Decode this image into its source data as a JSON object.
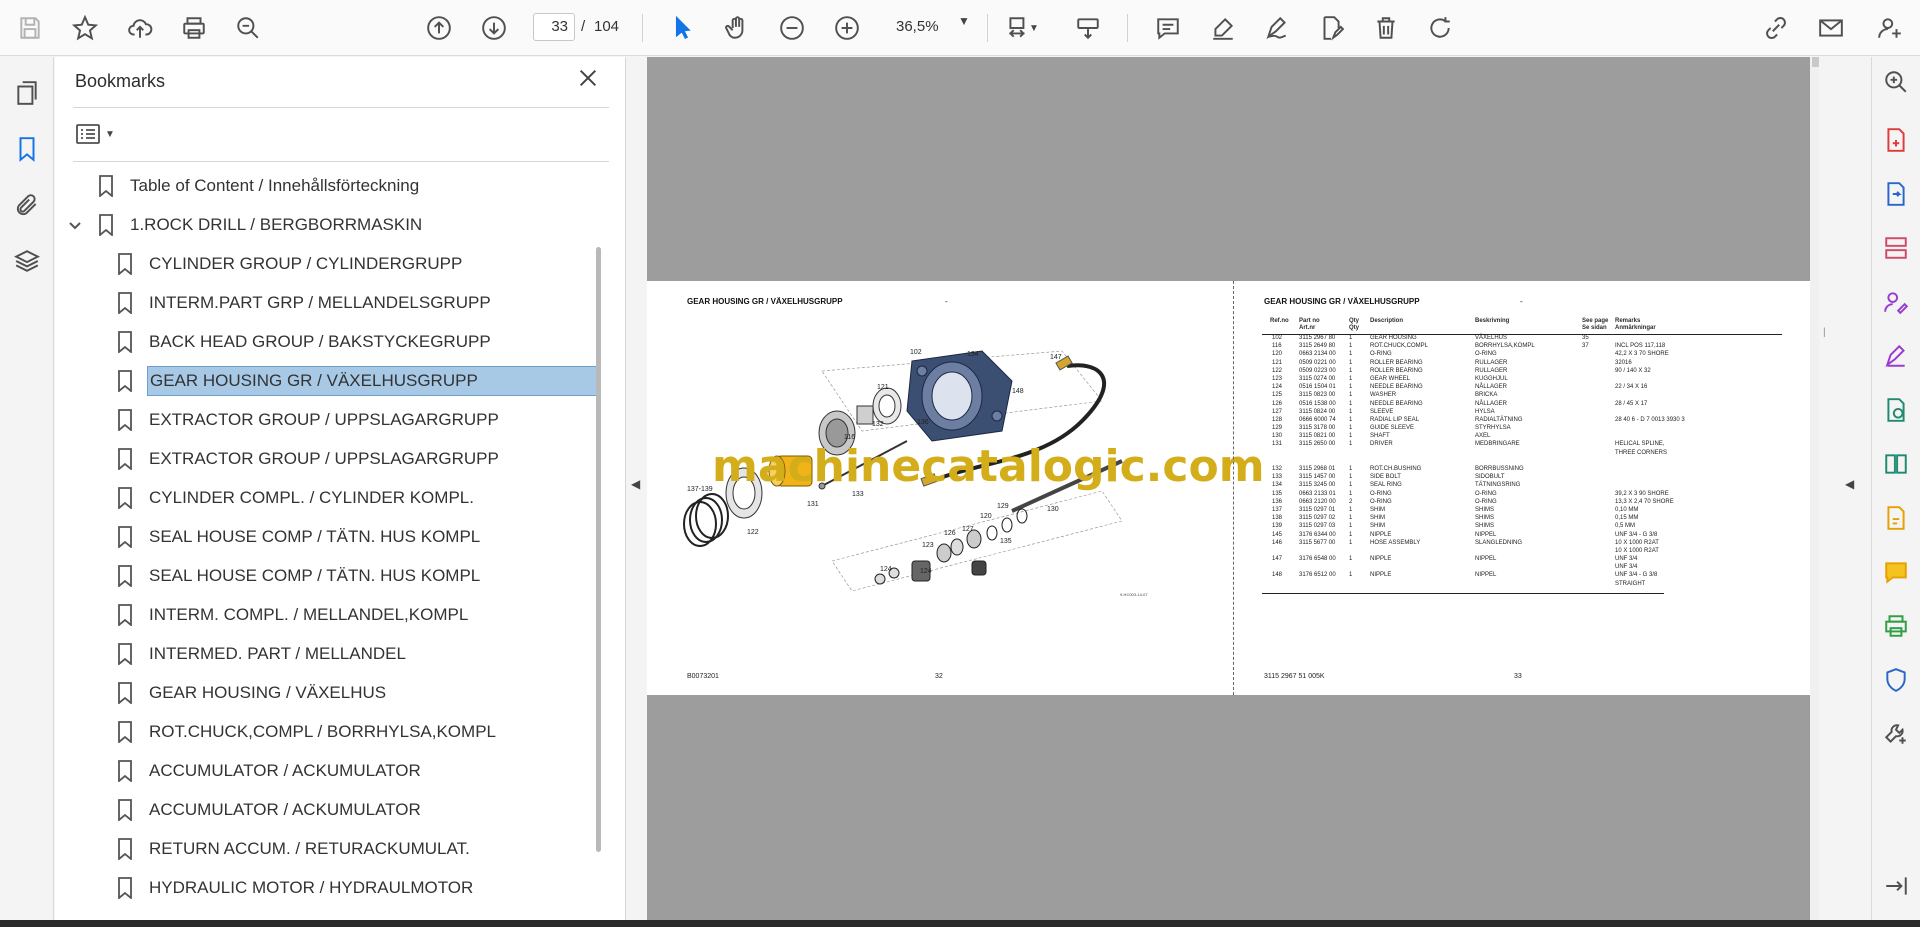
{
  "toolbar": {
    "current_page": "33",
    "page_separator": "/",
    "total_pages": "104",
    "zoom": "36,5%"
  },
  "bookmarks": {
    "title": "Bookmarks",
    "items": [
      {
        "label": "Table of Content / Innehållsförteckning",
        "level": 0
      },
      {
        "label": "1.ROCK DRILL / BERGBORRMASKIN",
        "level": 0,
        "expanded": true
      },
      {
        "label": "CYLINDER GROUP / CYLINDERGRUPP",
        "level": 1
      },
      {
        "label": "INTERM.PART GRP / MELLANDELSGRUPP",
        "level": 1
      },
      {
        "label": "BACK HEAD GROUP / BAKSTYCKEGRUPP",
        "level": 1
      },
      {
        "label": "GEAR HOUSING GR / VÄXELHUSGRUPP",
        "level": 1,
        "selected": true
      },
      {
        "label": "EXTRACTOR GROUP / UPPSLAGARGRUPP",
        "level": 1
      },
      {
        "label": "EXTRACTOR GROUP / UPPSLAGARGRUPP",
        "level": 1
      },
      {
        "label": "CYLINDER COMPL. / CYLINDER KOMPL.",
        "level": 1
      },
      {
        "label": "SEAL HOUSE COMP / TÄTN. HUS KOMPL",
        "level": 1
      },
      {
        "label": "SEAL HOUSE COMP / TÄTN. HUS KOMPL",
        "level": 1
      },
      {
        "label": "INTERM. COMPL. / MELLANDEL,KOMPL",
        "level": 1
      },
      {
        "label": "INTERMED. PART / MELLANDEL",
        "level": 1
      },
      {
        "label": "GEAR HOUSING / VÄXELHUS",
        "level": 1
      },
      {
        "label": "ROT.CHUCK,COMPL / BORRHYLSA,KOMPL",
        "level": 1
      },
      {
        "label": "ACCUMULATOR / ACKUMULATOR",
        "level": 1
      },
      {
        "label": "ACCUMULATOR / ACKUMULATOR",
        "level": 1
      },
      {
        "label": "RETURN ACCUM. / RETURACKUMULAT.",
        "level": 1
      },
      {
        "label": "HYDRAULIC MOTOR / HYDRAULMOTOR",
        "level": 1
      }
    ]
  },
  "document": {
    "left_page": {
      "heading": "GEAR HOUSING GR / VÄXELHUSGRUPP",
      "dash": "-",
      "footer_left": "B0073201",
      "footer_page": "32",
      "drawing_code": "9-HC003-14-07",
      "callouts": [
        "102",
        "134",
        "147",
        "148",
        "121",
        "132",
        "116",
        "136",
        "131",
        "133",
        "137-139",
        "122",
        "129",
        "120",
        "124",
        "127",
        "126",
        "123",
        "124",
        "135",
        "130"
      ]
    },
    "right_page": {
      "heading": "GEAR HOUSING GR / VÄXELHUSGRUPP",
      "dash": "-",
      "footer_left": "3115 2967 51 005K",
      "footer_page": "33",
      "columns": {
        "ref": "Ref.no",
        "part": "Part no",
        "part2": "Art.nr",
        "qty": "Qty",
        "qty2": "Qty",
        "desc": "Description",
        "besk": "Beskrivning",
        "see": "See page",
        "see2": "Se sidan",
        "rem": "Remarks",
        "rem2": "Anmärkningar"
      },
      "rows": [
        {
          "ref": "102",
          "part": "3115 2967 80",
          "qty": "1",
          "desc": "GEAR HOUSING",
          "besk": "VÄXELHUS",
          "see": "35",
          "rem": ""
        },
        {
          "ref": "116",
          "part": "3115 2649 80",
          "qty": "1",
          "desc": "ROT.CHUCK,COMPL",
          "besk": "BORRHYLSA,KOMPL",
          "see": "37",
          "rem": "INCL POS 117,118"
        },
        {
          "ref": "120",
          "part": "0663 2134 00",
          "qty": "1",
          "desc": "O-RING",
          "besk": "O-RING",
          "see": "",
          "rem": "42,2 X 3 70 SHORE"
        },
        {
          "ref": "121",
          "part": "0509 0221 00",
          "qty": "1",
          "desc": "ROLLER BEARING",
          "besk": "RULLAGER",
          "see": "",
          "rem": "32016"
        },
        {
          "ref": "122",
          "part": "0509 0223 00",
          "qty": "1",
          "desc": "ROLLER BEARING",
          "besk": "RULLAGER",
          "see": "",
          "rem": "90 / 140 X 32"
        },
        {
          "ref": "123",
          "part": "3115 0274 00",
          "qty": "1",
          "desc": "GEAR WHEEL",
          "besk": "KUGGHJUL",
          "see": "",
          "rem": ""
        },
        {
          "ref": "124",
          "part": "0516 1504 01",
          "qty": "1",
          "desc": "NEEDLE BEARING",
          "besk": "NÅLLAGER",
          "see": "",
          "rem": "22 / 34 X 16"
        },
        {
          "ref": "125",
          "part": "3115 0823 00",
          "qty": "1",
          "desc": "WASHER",
          "besk": "BRICKA",
          "see": "",
          "rem": ""
        },
        {
          "ref": "126",
          "part": "0516 1538 00",
          "qty": "1",
          "desc": "NEEDLE BEARING",
          "besk": "NÅLLAGER",
          "see": "",
          "rem": "28 / 45 X 17"
        },
        {
          "ref": "127",
          "part": "3115 0824 00",
          "qty": "1",
          "desc": "SLEEVE",
          "besk": "HYLSA",
          "see": "",
          "rem": ""
        },
        {
          "ref": "128",
          "part": "0666 6000 74",
          "qty": "1",
          "desc": "RADIAL LIP SEAL",
          "besk": "RADIALTÄTNING",
          "see": "",
          "rem": "28 40 6 - D 7 0013 3930 3"
        },
        {
          "ref": "129",
          "part": "3115 3178 00",
          "qty": "1",
          "desc": "GUIDE SLEEVE",
          "besk": "STYRHYLSA",
          "see": "",
          "rem": ""
        },
        {
          "ref": "130",
          "part": "3115 0821 00",
          "qty": "1",
          "desc": "SHAFT",
          "besk": "AXEL",
          "see": "",
          "rem": ""
        },
        {
          "ref": "131",
          "part": "3115 2650 00",
          "qty": "1",
          "desc": "DRIVER",
          "besk": "MEDBRINGARE",
          "see": "",
          "rem": "HELICAL SPLINE,"
        },
        {
          "ref": "",
          "part": "",
          "qty": "",
          "desc": "",
          "besk": "",
          "see": "",
          "rem": "THREE CORNERS"
        },
        {
          "ref": "",
          "part": "",
          "qty": "",
          "desc": "",
          "besk": "",
          "see": "",
          "rem": ""
        },
        {
          "ref": "132",
          "part": "3115 2968 01",
          "qty": "1",
          "desc": "ROT.CH.BUSHING",
          "besk": "BORRBUSSNING",
          "see": "",
          "rem": ""
        },
        {
          "ref": "133",
          "part": "3115 1457 00",
          "qty": "1",
          "desc": "SIDE BOLT",
          "besk": "SIDOBULT",
          "see": "",
          "rem": ""
        },
        {
          "ref": "134",
          "part": "3115 3245 00",
          "qty": "1",
          "desc": "SEAL RING",
          "besk": "TÄTNINGSRING",
          "see": "",
          "rem": ""
        },
        {
          "ref": "135",
          "part": "0663 2133 01",
          "qty": "1",
          "desc": "O-RING",
          "besk": "O-RING",
          "see": "",
          "rem": "39,2 X 3 90 SHORE"
        },
        {
          "ref": "136",
          "part": "0663 2120 00",
          "qty": "2",
          "desc": "O-RING",
          "besk": "O-RING",
          "see": "",
          "rem": "13,3 X 2,4 70 SHORE"
        },
        {
          "ref": "137",
          "part": "3115 0297 01",
          "qty": "1",
          "desc": "SHIM",
          "besk": "SHIMS",
          "see": "",
          "rem": "0,10 MM"
        },
        {
          "ref": "138",
          "part": "3115 0297 02",
          "qty": "1",
          "desc": "SHIM",
          "besk": "SHIMS",
          "see": "",
          "rem": "0,15 MM"
        },
        {
          "ref": "139",
          "part": "3115 0297 03",
          "qty": "1",
          "desc": "SHIM",
          "besk": "SHIMS",
          "see": "",
          "rem": "0,5 MM"
        },
        {
          "ref": "145",
          "part": "3176 6344 00",
          "qty": "1",
          "desc": "NIPPLE",
          "besk": "NIPPEL",
          "see": "",
          "rem": "UNF 3/4 - G 3/8"
        },
        {
          "ref": "146",
          "part": "3115 5677 00",
          "qty": "1",
          "desc": "HOSE ASSEMBLY",
          "besk": "SLANGLEDNING",
          "see": "",
          "rem": "10 X 1000 R2AT"
        },
        {
          "ref": "",
          "part": "",
          "qty": "",
          "desc": "",
          "besk": "",
          "see": "",
          "rem": "10 X 1000 R2AT"
        },
        {
          "ref": "147",
          "part": "3176 6548 00",
          "qty": "1",
          "desc": "NIPPLE",
          "besk": "NIPPEL",
          "see": "",
          "rem": "UNF 3/4"
        },
        {
          "ref": "",
          "part": "",
          "qty": "",
          "desc": "",
          "besk": "",
          "see": "",
          "rem": "UNF 3/4"
        },
        {
          "ref": "148",
          "part": "3176 6512 00",
          "qty": "1",
          "desc": "NIPPLE",
          "besk": "NIPPEL",
          "see": "",
          "rem": "UNF 3/4 - G 3/8"
        },
        {
          "ref": "",
          "part": "",
          "qty": "",
          "desc": "",
          "besk": "",
          "see": "",
          "rem": "STRAIGHT"
        }
      ]
    },
    "watermark": "machinecatalogic.com"
  },
  "colors": {
    "accent": "#1473e6",
    "selection": "#a8c9e6",
    "doc_background": "#9d9d9d",
    "watermark": "#d4ad1a",
    "housing_blue": "#3b4f73",
    "driver_yellow": "#f0b418"
  }
}
